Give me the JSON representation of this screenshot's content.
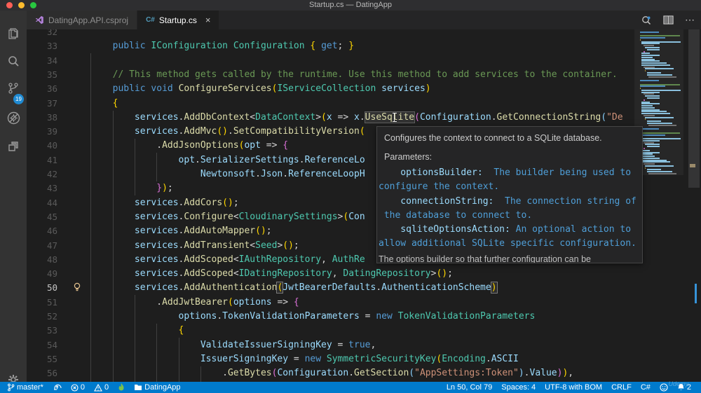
{
  "window": {
    "title": "Startup.cs — DatingApp"
  },
  "colors": {
    "accent": "#007ACC",
    "editor_bg": "#1E1E1E",
    "activity_bg": "#333333",
    "tab_bg": "#252526",
    "active_tab_bg": "#1E1E1E",
    "title_bg": "#2E2E30"
  },
  "tabs": [
    {
      "label": "DatingApp.API.csproj",
      "icon": "vs-project-icon",
      "active": false
    },
    {
      "label": "Startup.cs",
      "icon": "csharp-icon",
      "active": true,
      "close": "×"
    }
  ],
  "activity_bar": {
    "source_control_badge": "19"
  },
  "editor": {
    "current_line": 50,
    "lines": [
      {
        "n": 32,
        "tokens": []
      },
      {
        "n": 33,
        "tokens": [
          [
            "pre",
            "        "
          ],
          [
            "kw",
            "public "
          ],
          [
            "ty",
            "IConfiguration "
          ],
          [
            "ty",
            "Configuration "
          ],
          [
            "b1",
            "{ "
          ],
          [
            "kw",
            "get"
          ],
          [
            "pl",
            "; "
          ],
          [
            "b1",
            "}"
          ]
        ]
      },
      {
        "n": 34,
        "tokens": []
      },
      {
        "n": 35,
        "tokens": [
          [
            "pre",
            "        "
          ],
          [
            "co",
            "// This method gets called by the runtime. Use this method to add services to the container."
          ]
        ]
      },
      {
        "n": 36,
        "tokens": [
          [
            "pre",
            "        "
          ],
          [
            "kw",
            "public "
          ],
          [
            "kw",
            "void "
          ],
          [
            "fn",
            "ConfigureServices"
          ],
          [
            "b1",
            "("
          ],
          [
            "ty",
            "IServiceCollection "
          ],
          [
            "va",
            "services"
          ],
          [
            "b1",
            ")"
          ]
        ]
      },
      {
        "n": 37,
        "tokens": [
          [
            "pre",
            "        "
          ],
          [
            "b1",
            "{"
          ]
        ]
      },
      {
        "n": 38,
        "tokens": [
          [
            "pre",
            "            "
          ],
          [
            "va",
            "services"
          ],
          [
            "pl",
            "."
          ],
          [
            "fn",
            "AddDbContext"
          ],
          [
            "pl",
            "<"
          ],
          [
            "ty",
            "DataContext"
          ],
          [
            "pl",
            ">"
          ],
          [
            "b1",
            "("
          ],
          [
            "va",
            "x "
          ],
          [
            "pl",
            "=> "
          ],
          [
            "va",
            "x"
          ],
          [
            "pl",
            "."
          ],
          [
            "fnh",
            "UseSqlite"
          ],
          [
            "b2",
            "("
          ],
          [
            "va",
            "Configuration"
          ],
          [
            "pl",
            "."
          ],
          [
            "fn",
            "GetConnectionString"
          ],
          [
            "b3",
            "("
          ],
          [
            "st",
            "\"De"
          ]
        ]
      },
      {
        "n": 39,
        "tokens": [
          [
            "pre",
            "            "
          ],
          [
            "va",
            "services"
          ],
          [
            "pl",
            "."
          ],
          [
            "fn",
            "AddMvc"
          ],
          [
            "b1",
            "()"
          ],
          [
            "pl",
            "."
          ],
          [
            "fn",
            "SetCompatibilityVersion"
          ],
          [
            "b1",
            "("
          ]
        ]
      },
      {
        "n": 40,
        "tokens": [
          [
            "pre",
            "                "
          ],
          [
            "pl",
            "."
          ],
          [
            "fn",
            "AddJsonOptions"
          ],
          [
            "b1",
            "("
          ],
          [
            "va",
            "opt "
          ],
          [
            "pl",
            "=> "
          ],
          [
            "b2",
            "{"
          ]
        ]
      },
      {
        "n": 41,
        "tokens": [
          [
            "pre",
            "                    "
          ],
          [
            "va",
            "opt"
          ],
          [
            "pl",
            "."
          ],
          [
            "va",
            "SerializerSettings"
          ],
          [
            "pl",
            "."
          ],
          [
            "va",
            "ReferenceLo"
          ]
        ]
      },
      {
        "n": 42,
        "tokens": [
          [
            "pre",
            "                        "
          ],
          [
            "va",
            "Newtonsoft"
          ],
          [
            "pl",
            "."
          ],
          [
            "va",
            "Json"
          ],
          [
            "pl",
            "."
          ],
          [
            "va",
            "ReferenceLoopH"
          ]
        ]
      },
      {
        "n": 43,
        "tokens": [
          [
            "pre",
            "                "
          ],
          [
            "b2",
            "}"
          ],
          [
            "b1",
            ")"
          ],
          [
            "pl",
            ";"
          ]
        ]
      },
      {
        "n": 44,
        "tokens": [
          [
            "pre",
            "            "
          ],
          [
            "va",
            "services"
          ],
          [
            "pl",
            "."
          ],
          [
            "fn",
            "AddCors"
          ],
          [
            "b1",
            "()"
          ],
          [
            "pl",
            ";"
          ]
        ]
      },
      {
        "n": 45,
        "tokens": [
          [
            "pre",
            "            "
          ],
          [
            "va",
            "services"
          ],
          [
            "pl",
            "."
          ],
          [
            "fn",
            "Configure"
          ],
          [
            "pl",
            "<"
          ],
          [
            "ty",
            "CloudinarySettings"
          ],
          [
            "pl",
            ">"
          ],
          [
            "b1",
            "("
          ],
          [
            "va",
            "Con"
          ]
        ]
      },
      {
        "n": 46,
        "tokens": [
          [
            "pre",
            "            "
          ],
          [
            "va",
            "services"
          ],
          [
            "pl",
            "."
          ],
          [
            "fn",
            "AddAutoMapper"
          ],
          [
            "b1",
            "()"
          ],
          [
            "pl",
            ";"
          ]
        ]
      },
      {
        "n": 47,
        "tokens": [
          [
            "pre",
            "            "
          ],
          [
            "va",
            "services"
          ],
          [
            "pl",
            "."
          ],
          [
            "fn",
            "AddTransient"
          ],
          [
            "pl",
            "<"
          ],
          [
            "ty",
            "Seed"
          ],
          [
            "pl",
            ">"
          ],
          [
            "b1",
            "()"
          ],
          [
            "pl",
            ";"
          ]
        ]
      },
      {
        "n": 48,
        "tokens": [
          [
            "pre",
            "            "
          ],
          [
            "va",
            "services"
          ],
          [
            "pl",
            "."
          ],
          [
            "fn",
            "AddScoped"
          ],
          [
            "pl",
            "<"
          ],
          [
            "ty",
            "IAuthRepository"
          ],
          [
            "pl",
            ", "
          ],
          [
            "ty",
            "AuthRe"
          ]
        ]
      },
      {
        "n": 49,
        "tokens": [
          [
            "pre",
            "            "
          ],
          [
            "va",
            "services"
          ],
          [
            "pl",
            "."
          ],
          [
            "fn",
            "AddScoped"
          ],
          [
            "pl",
            "<"
          ],
          [
            "ty",
            "IDatingRepository"
          ],
          [
            "pl",
            ", "
          ],
          [
            "ty",
            "DatingRepository"
          ],
          [
            "pl",
            ">"
          ],
          [
            "b1",
            "()"
          ],
          [
            "pl",
            ";"
          ]
        ]
      },
      {
        "n": 50,
        "tokens": [
          [
            "pre",
            "            "
          ],
          [
            "va",
            "services"
          ],
          [
            "pl",
            "."
          ],
          [
            "fn",
            "AddAuthentication"
          ],
          [
            "b1m",
            "("
          ],
          [
            "va",
            "JwtBearerDefaults"
          ],
          [
            "pl",
            "."
          ],
          [
            "va",
            "AuthenticationScheme"
          ],
          [
            "b1m",
            ")"
          ]
        ]
      },
      {
        "n": 51,
        "tokens": [
          [
            "pre",
            "                "
          ],
          [
            "pl",
            "."
          ],
          [
            "fn",
            "AddJwtBearer"
          ],
          [
            "b1",
            "("
          ],
          [
            "va",
            "options "
          ],
          [
            "pl",
            "=> "
          ],
          [
            "b2",
            "{"
          ]
        ]
      },
      {
        "n": 52,
        "tokens": [
          [
            "pre",
            "                    "
          ],
          [
            "va",
            "options"
          ],
          [
            "pl",
            "."
          ],
          [
            "va",
            "TokenValidationParameters "
          ],
          [
            "pl",
            "= "
          ],
          [
            "kw",
            "new "
          ],
          [
            "ty",
            "TokenValidationParameters"
          ]
        ]
      },
      {
        "n": 53,
        "tokens": [
          [
            "pre",
            "                    "
          ],
          [
            "b1",
            "{"
          ]
        ]
      },
      {
        "n": 54,
        "tokens": [
          [
            "pre",
            "                        "
          ],
          [
            "va",
            "ValidateIssuerSigningKey "
          ],
          [
            "pl",
            "= "
          ],
          [
            "kw",
            "true"
          ],
          [
            "pl",
            ","
          ]
        ]
      },
      {
        "n": 55,
        "tokens": [
          [
            "pre",
            "                        "
          ],
          [
            "va",
            "IssuerSigningKey "
          ],
          [
            "pl",
            "= "
          ],
          [
            "kw",
            "new "
          ],
          [
            "ty",
            "SymmetricSecurityKey"
          ],
          [
            "b1",
            "("
          ],
          [
            "ty",
            "Encoding"
          ],
          [
            "pl",
            "."
          ],
          [
            "va",
            "ASCII"
          ]
        ]
      },
      {
        "n": 56,
        "tokens": [
          [
            "pre",
            "                            "
          ],
          [
            "pl",
            "."
          ],
          [
            "fn",
            "GetBytes"
          ],
          [
            "b2",
            "("
          ],
          [
            "va",
            "Configuration"
          ],
          [
            "pl",
            "."
          ],
          [
            "fn",
            "GetSection"
          ],
          [
            "b3",
            "("
          ],
          [
            "st",
            "\"AppSettings:Token\""
          ],
          [
            "b3",
            ")"
          ],
          [
            "pl",
            "."
          ],
          [
            "va",
            "Value"
          ],
          [
            "b2",
            ")"
          ],
          [
            "b1",
            ")"
          ],
          [
            "pl",
            ","
          ]
        ]
      }
    ]
  },
  "hover_tooltip": {
    "summary": "Configures the context to connect to a SQLite database.",
    "parameters_label": "Parameters:",
    "lines": [
      {
        "name": "    optionsBuilder:",
        "desc": "  The builder being used to"
      },
      {
        "name": "",
        "desc": "configure the context."
      },
      {
        "name": "    connectionString:",
        "desc": "  The connection string of"
      },
      {
        "name": "",
        "desc": " the database to connect to."
      },
      {
        "name": "    sqliteOptionsAction:",
        "desc": " An optional action to"
      },
      {
        "name": "",
        "desc": "allow additional SQLite specific configuration."
      }
    ],
    "truncated_line": "The options builder so that further configuration can be"
  },
  "status_bar": {
    "branch": "master*",
    "errors": "0",
    "warnings": "0",
    "folder": "DatingApp",
    "line_col": "Ln 50, Col 79",
    "indent": "Spaces: 4",
    "encoding": "UTF-8 with BOM",
    "eol": "CRLF",
    "language": "C#",
    "bell_badge": "2"
  },
  "watermark": "Udemy"
}
